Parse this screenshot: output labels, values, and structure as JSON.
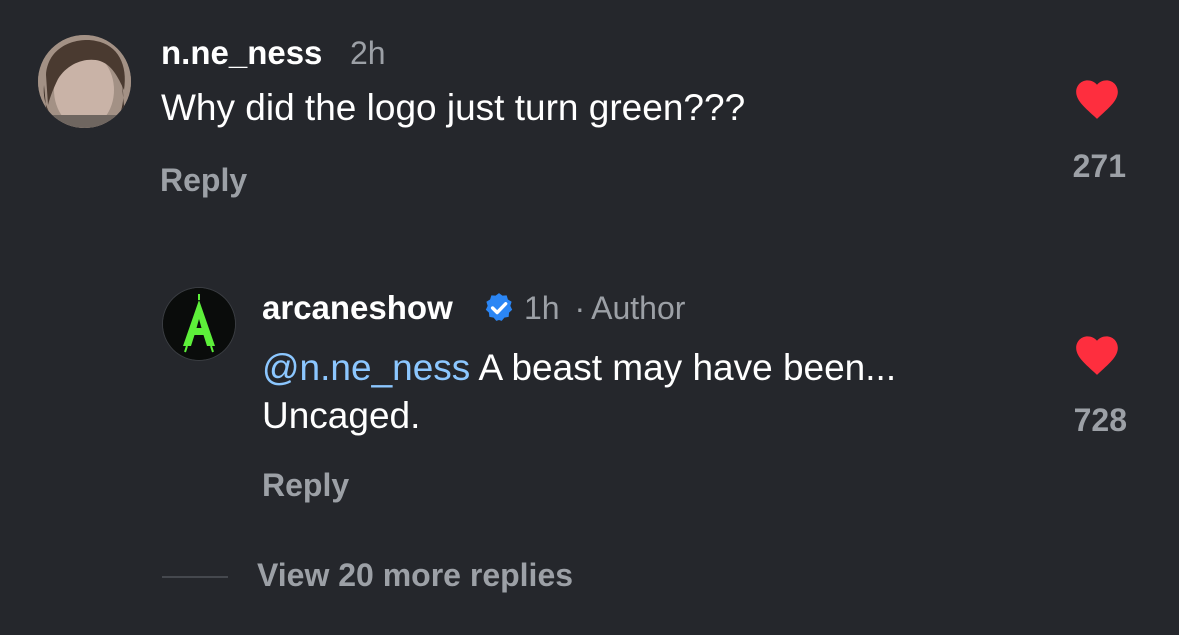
{
  "comments": [
    {
      "username": "n.ne_ness",
      "time": "2h",
      "text": "Why did the logo just turn green???",
      "reply_label": "Reply",
      "likes": "271",
      "avatar_icon": "user-photo-avatar",
      "heart_color": "#fe2e3e"
    }
  ],
  "reply": {
    "username": "arcaneshow",
    "verified_icon": "verified-badge-icon",
    "verified_color": "#2b86f5",
    "time": "1h",
    "separator": "·",
    "author_label": "Author",
    "mention": "@n.ne_ness",
    "text_line1": " A beast may have been...",
    "text_line2": "Uncaged.",
    "reply_label": "Reply",
    "likes": "728",
    "avatar_letter": "A",
    "avatar_accent": "#5df03a",
    "heart_color": "#fe2e3e"
  },
  "view_more": "View 20 more replies"
}
